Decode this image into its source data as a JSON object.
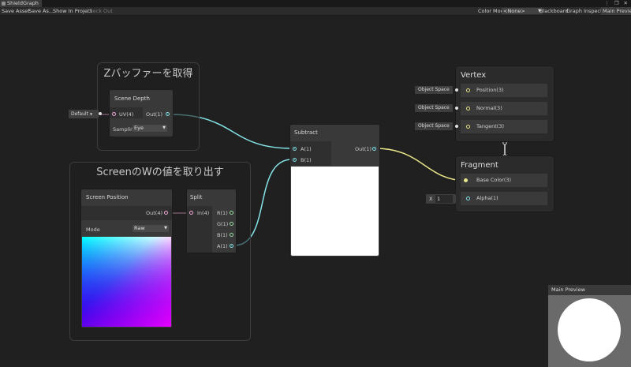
{
  "window": {
    "tab_title": "ShieldGraph",
    "controls": "⋮ ❐ ✕"
  },
  "toolbar": {
    "save_asset": "Save Asset",
    "save_as": "Save As...",
    "show_in_project": "Show In Project",
    "check_out": "Check Out",
    "color_mode_label": "Color Mode",
    "color_mode_value": "<None>",
    "blackboard": "Blackboard",
    "graph_inspector": "Graph Inspector",
    "main_preview": "Main Preview"
  },
  "groups": {
    "depth_group_title": "Zバッファーを取得",
    "screen_group_title": "ScreenのWの値を取り出す"
  },
  "scene_depth": {
    "title": "Scene Depth",
    "uv_default": "Default",
    "uv_port": "UV(4)",
    "out_port": "Out(1)",
    "sampling_label": "Samplin",
    "sampling_value": "Eye"
  },
  "screen_position": {
    "title": "Screen Position",
    "out_port": "Out(4)",
    "mode_label": "Mode",
    "mode_value": "Raw"
  },
  "split": {
    "title": "Split",
    "in_port": "In(4)",
    "r": "R(1)",
    "g": "G(1)",
    "b": "B(1)",
    "a": "A(1)"
  },
  "subtract": {
    "title": "Subtract",
    "a": "A(1)",
    "b": "B(1)",
    "out": "Out(1)"
  },
  "vertex": {
    "title": "Vertex",
    "position": "Position(3)",
    "normal": "Normal(3)",
    "tangent": "Tangent(3)",
    "space_position": "Object Space",
    "space_normal": "Object Space",
    "space_tangent": "Object Space"
  },
  "fragment": {
    "title": "Fragment",
    "base_color": "Base Color(3)",
    "alpha": "Alpha(1)",
    "alpha_x_label": "X",
    "alpha_value": "1"
  },
  "main_preview": {
    "title": "Main Preview"
  },
  "colors": {
    "edge_float": "#84e4e7",
    "edge_vector": "#f0a8d8",
    "edge_color": "#e9e58a"
  }
}
